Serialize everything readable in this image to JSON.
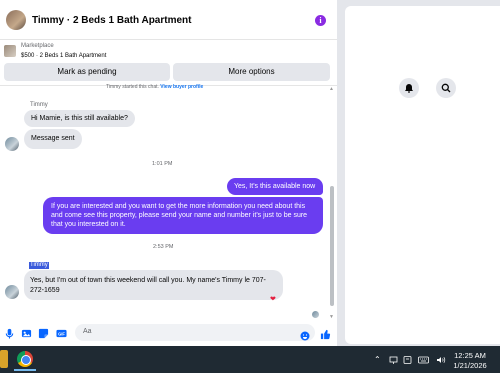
{
  "header": {
    "title": "Timmy · 2 Beds 1 Bath Apartment",
    "info_icon": "i"
  },
  "listing": {
    "source": "Marketplace",
    "title": "$500 · 2 Beds 1 Bath Apartment",
    "mark_pending_label": "Mark as pending",
    "more_options_label": "More options"
  },
  "thread": {
    "started_text": "Timmy started this chat.",
    "view_profile_label": "View buyer profile",
    "sender_name": "Timmy",
    "messages_in": [
      "Hi Mamie, is this still available?",
      "Message sent"
    ],
    "time_1": "1:01 PM",
    "messages_out": [
      "Yes, It's this available now",
      "If you are interested and you want to get the more information you need about this and come see this property, please send your name and number it's just to be sure that you interested on it."
    ],
    "time_2": "2:53 PM",
    "sender_name_2": "Timmy",
    "reply": "Yes, but I'm out of town this weekend will call you. My name's Timmy le 707-272-1659",
    "reaction": "❤"
  },
  "composer": {
    "placeholder": "Aa"
  },
  "taskbar": {
    "time": "12:25 AM",
    "date": "1/21/2026"
  },
  "colors": {
    "accent": "#6a3df0",
    "bubble_in": "#e4e6eb",
    "taskbar": "#1f2a33"
  }
}
